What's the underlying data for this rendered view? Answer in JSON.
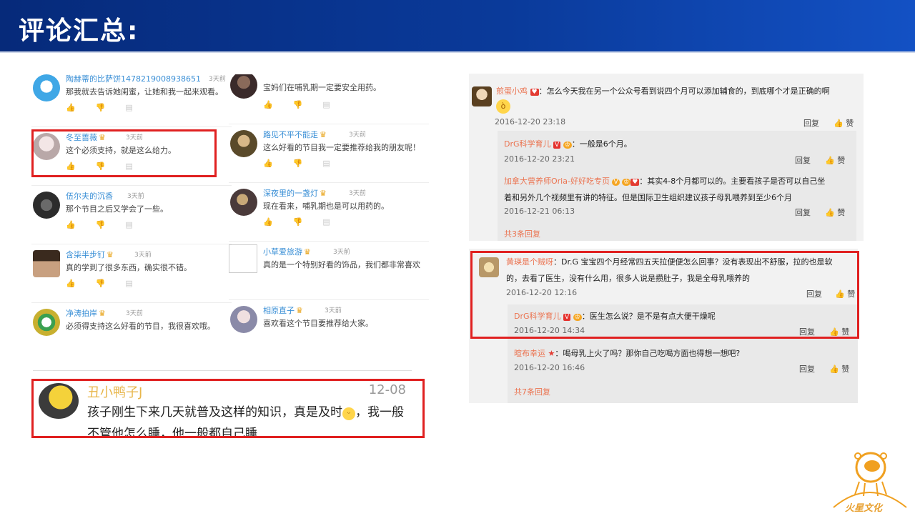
{
  "header": {
    "title": "评论汇总:"
  },
  "left_col_a": [
    {
      "name": "陶赫蒂的比萨饼1478219008938651",
      "time": "3天前",
      "text": "那我就去告诉她闺蜜，让她和我一起来观看。",
      "avatar_color": "#3fa7e6"
    },
    {
      "name": "冬至蔷薇",
      "time": "3天前",
      "text": "这个必须支持，就是这么给力。",
      "avatar_color": "#d8c8c8"
    },
    {
      "name": "伍尔夫的沉香",
      "time": "3天前",
      "text": "那个节目之后又学会了一些。",
      "avatar_color": "#2c2c2c"
    },
    {
      "name": "含柒半步钉",
      "time": "3天前",
      "text": "真的学到了很多东西，确实很不错。",
      "avatar_color": "#6b5a48"
    },
    {
      "name": "净涛拍岸",
      "time": "3天前",
      "text": "必须得支持这么好看的节目，我很喜欢哦。",
      "avatar_color": "#9a8a3a"
    }
  ],
  "left_col_b": [
    {
      "name": "",
      "time": "",
      "text": "宝妈们在哺乳期一定要安全用药。",
      "avatar_color": "#3a2a2a"
    },
    {
      "name": "路见不平不能走",
      "time": "3天前",
      "text": "这么好看的节目我一定要推荐给我的朋友呢！",
      "avatar_color": "#5a4a2a"
    },
    {
      "name": "深夜里的一盏灯",
      "time": "3天前",
      "text": "现在看来，哺乳期也是可以用药的。",
      "avatar_color": "#4a3a3a"
    },
    {
      "name": "小草爱旅游",
      "time": "3天前",
      "text": "真的是一个特别好看的饰品，我们都非常喜欢",
      "avatar_color": "#ffffff"
    },
    {
      "name": "相原直子",
      "time": "3天前",
      "text": "喜欢看这个节目要推荐给大家。",
      "avatar_color": "#8a8aa8"
    }
  ],
  "big_comment": {
    "name": "丑小鸭子J",
    "date": "12-08",
    "text": "孩子刚生下来几天就普及这样的知识，真是及时",
    "text2": "，我一般不管他怎么睡，他一般都自己睡"
  },
  "right_panel_1": {
    "main": {
      "user": "煎蛋小鸡",
      "text": "：怎么今天我在另一个公众号看到说四个月可以添加辅食的，到底哪个才是正确的啊",
      "date": "2016-12-20 23:18",
      "reply": "回复",
      "like": "赞"
    },
    "reply1": {
      "user": "DrG科学育儿",
      "text": "：一般是6个月。",
      "date": "2016-12-20 23:21",
      "reply": "回复",
      "like": "赞"
    },
    "reply2": {
      "user": "加拿大营养师Oria-好好吃专页",
      "text": "：其实4-8个月都可以的。主要看孩子是否可以自己坐",
      "text2": "着和另外几个视频里有讲的特征。但是国际卫生组织建议孩子母乳喂养到至少6个月",
      "date": "2016-12-21 06:13",
      "reply": "回复",
      "like": "赞"
    },
    "more": "共3条回复"
  },
  "right_panel_2": {
    "main": {
      "user": "黄瑛是个贼呀",
      "text": "：Dr.G 宝宝四个月经常四五天拉便便怎么回事？没有表现出不舒服，拉的也是软",
      "text2": "的，去看了医生，没有什么用，很多人说是攒肚子，我是全母乳喂养的",
      "date": "2016-12-20 12:16",
      "reply": "回复",
      "like": "赞"
    },
    "reply1": {
      "user": "DrG科学育儿",
      "text": "：医生怎么说？是不是有点大便干燥呢",
      "date": "2016-12-20 14:34",
      "reply": "回复",
      "like": "赞"
    },
    "reply2": {
      "user": "暄布幸运",
      "text": "：喝母乳上火了吗？那你自己吃喝方面也得想一想吧?",
      "date": "2016-12-20 16:46",
      "reply": "回复",
      "like": "赞"
    },
    "more": "共7条回复"
  },
  "colors": {
    "highlight": "#e02020",
    "username": "#3a8fd6",
    "orange_user": "#eb7350",
    "header": "#0a3a9a"
  },
  "logo": {
    "text": "火星文化"
  }
}
